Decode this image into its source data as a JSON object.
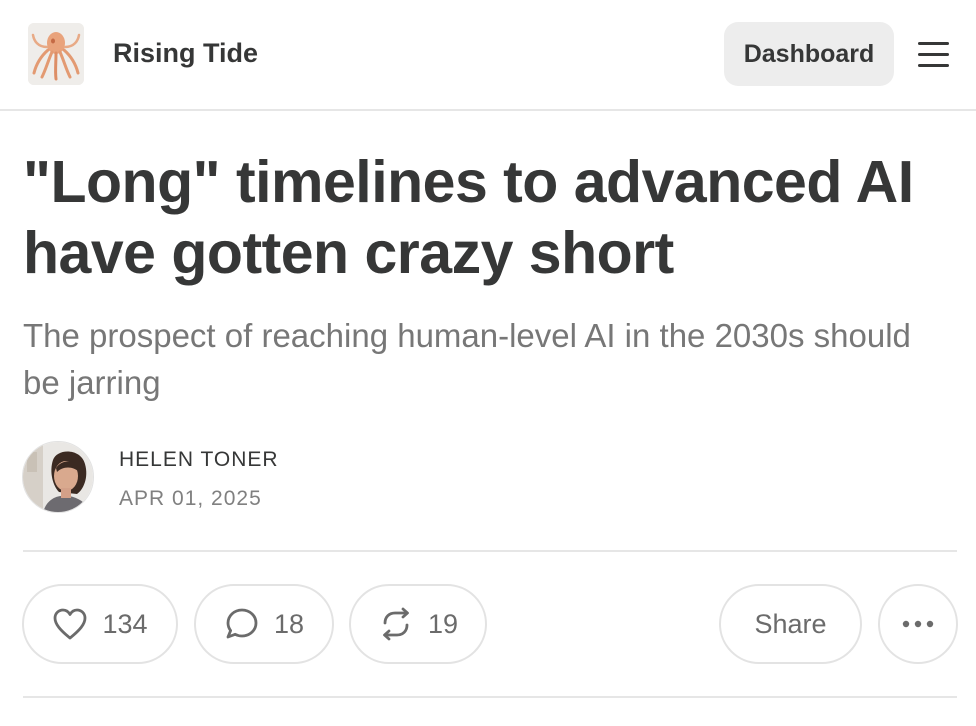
{
  "header": {
    "publication_name": "Rising Tide",
    "dashboard_label": "Dashboard",
    "logo_icon": "octopus-illustration",
    "menu_icon": "hamburger-menu-icon"
  },
  "post": {
    "title": "\"Long\" timelines to advanced AI have gotten crazy short",
    "subtitle": "The prospect of reaching human-level AI in the 2030s should be jarring",
    "author": "HELEN TONER",
    "date": "APR 01, 2025"
  },
  "actions": {
    "likes": "134",
    "comments": "18",
    "restacks": "19",
    "share_label": "Share",
    "icons": [
      "heart-icon",
      "comment-icon",
      "restack-icon",
      "more-icon"
    ]
  },
  "colors": {
    "text": "#363737",
    "muted": "#777777",
    "button_bg": "#ededed",
    "border": "#e3e3e3"
  }
}
